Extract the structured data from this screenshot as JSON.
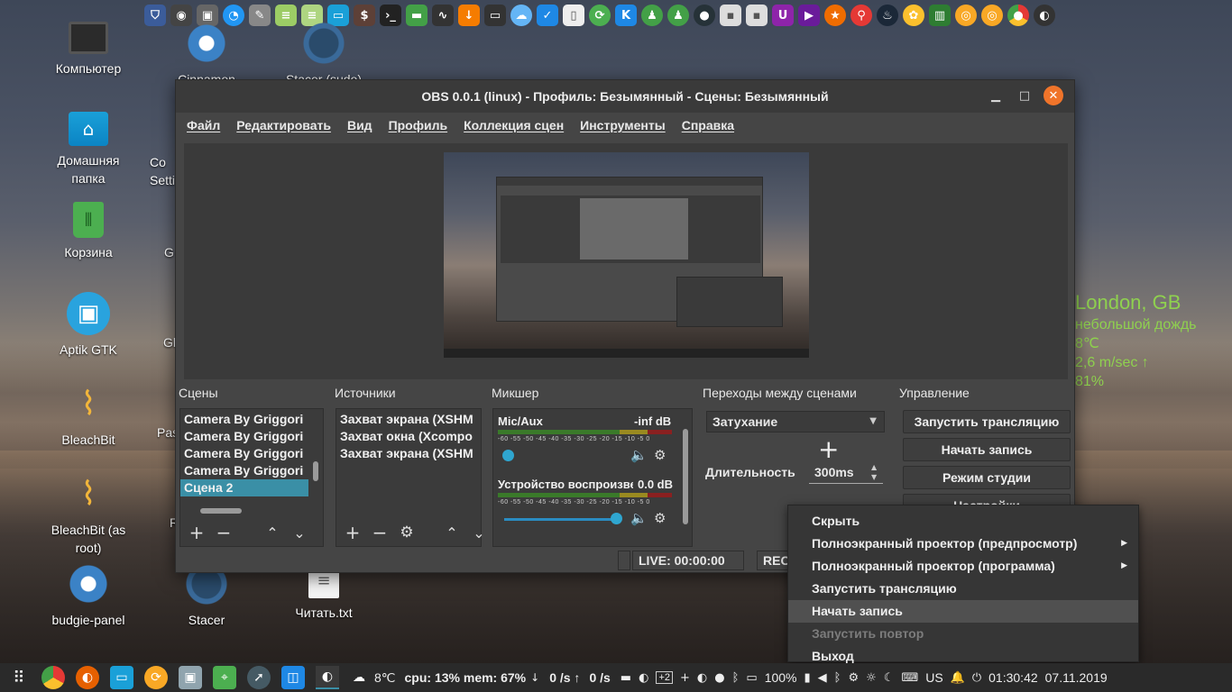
{
  "desktop": {
    "icons": [
      {
        "label": "Компьютер"
      },
      {
        "label": "Cinnamon"
      },
      {
        "label": "Stacer (sudo)"
      },
      {
        "label": "Домашняя папка"
      },
      {
        "label": "Корзина"
      },
      {
        "label": "Aptik GTK"
      },
      {
        "label": "BleachBit"
      },
      {
        "label": "BleachBit (as root)"
      },
      {
        "label": "budgie-panel"
      },
      {
        "label": "Stacer"
      },
      {
        "label": "Читать.txt"
      },
      {
        "label": "Co Setti"
      },
      {
        "label": "G"
      },
      {
        "label": "Gl"
      },
      {
        "label": "Pas"
      },
      {
        "label": "R"
      }
    ]
  },
  "weather": {
    "city": "London, GB",
    "condition": "небольшой дождь",
    "temperature": "8℃",
    "wind": "2,6 m/sec ↑",
    "humidity": "81%"
  },
  "obs": {
    "title": "OBS 0.0.1 (linux) - Профиль: Безымянный - Сцены: Безымянный",
    "menu": [
      "Файл",
      "Редактировать",
      "Вид",
      "Профиль",
      "Коллекция сцен",
      "Инструменты",
      "Справка"
    ],
    "sections": {
      "scenes": "Сцены",
      "sources": "Источники",
      "mixer": "Микшер",
      "transitions": "Переходы между сценами",
      "controls": "Управление"
    },
    "scenes": [
      "Camera By Griggori",
      "Camera By Griggori",
      "Camera By Griggori",
      "Camera By Griggori",
      "Сцена 2"
    ],
    "selected_scene": "Сцена 2",
    "sources": [
      "Захват экрана (XSHM",
      "Захват окна (Xcompo",
      "Захват экрана (XSHM"
    ],
    "mixer": [
      {
        "name": "Mic/Aux",
        "db": "-inf dB",
        "level": 0.0
      },
      {
        "name": "Устройство воспроизве",
        "db": "0.0 dB",
        "level": 1.0
      }
    ],
    "meter_scale": "-60 -55 -50 -45 -40 -35 -30 -25 -20 -15 -10 -5 0",
    "transition": {
      "selected": "Затухание",
      "duration_label": "Длительность",
      "duration_value": "300ms"
    },
    "controls": [
      "Запустить трансляцию",
      "Начать запись",
      "Режим студии",
      "Настройки"
    ],
    "status": {
      "live": "LIVE: 00:00:00",
      "rec": "REC"
    }
  },
  "context_menu": {
    "items": [
      {
        "label": "Скрыть",
        "state": "normal",
        "submenu": false
      },
      {
        "label": "Полноэкранный проектор (предпросмотр)",
        "state": "normal",
        "submenu": true
      },
      {
        "label": "Полноэкранный проектор (программа)",
        "state": "normal",
        "submenu": true
      },
      {
        "label": "Запустить трансляцию",
        "state": "normal",
        "submenu": false
      },
      {
        "label": "Начать запись",
        "state": "highlighted",
        "submenu": false
      },
      {
        "label": "Запустить повтор",
        "state": "disabled",
        "submenu": false
      },
      {
        "label": "Выход",
        "state": "normal",
        "submenu": false
      }
    ]
  },
  "taskbar": {
    "weather_temp": "8℃",
    "sysmon": "cpu: 13% mem: 67%",
    "net_up": "0 /s ↑",
    "net_down": "0 /s",
    "workspace": "+2",
    "battery": "100%",
    "keyboard": "US",
    "time": "01:30:42",
    "date": "07.11.2019"
  },
  "colors": {
    "accent": "#3a8fa6",
    "close_button": "#f0742a",
    "weather_text": "#8fd14f"
  }
}
